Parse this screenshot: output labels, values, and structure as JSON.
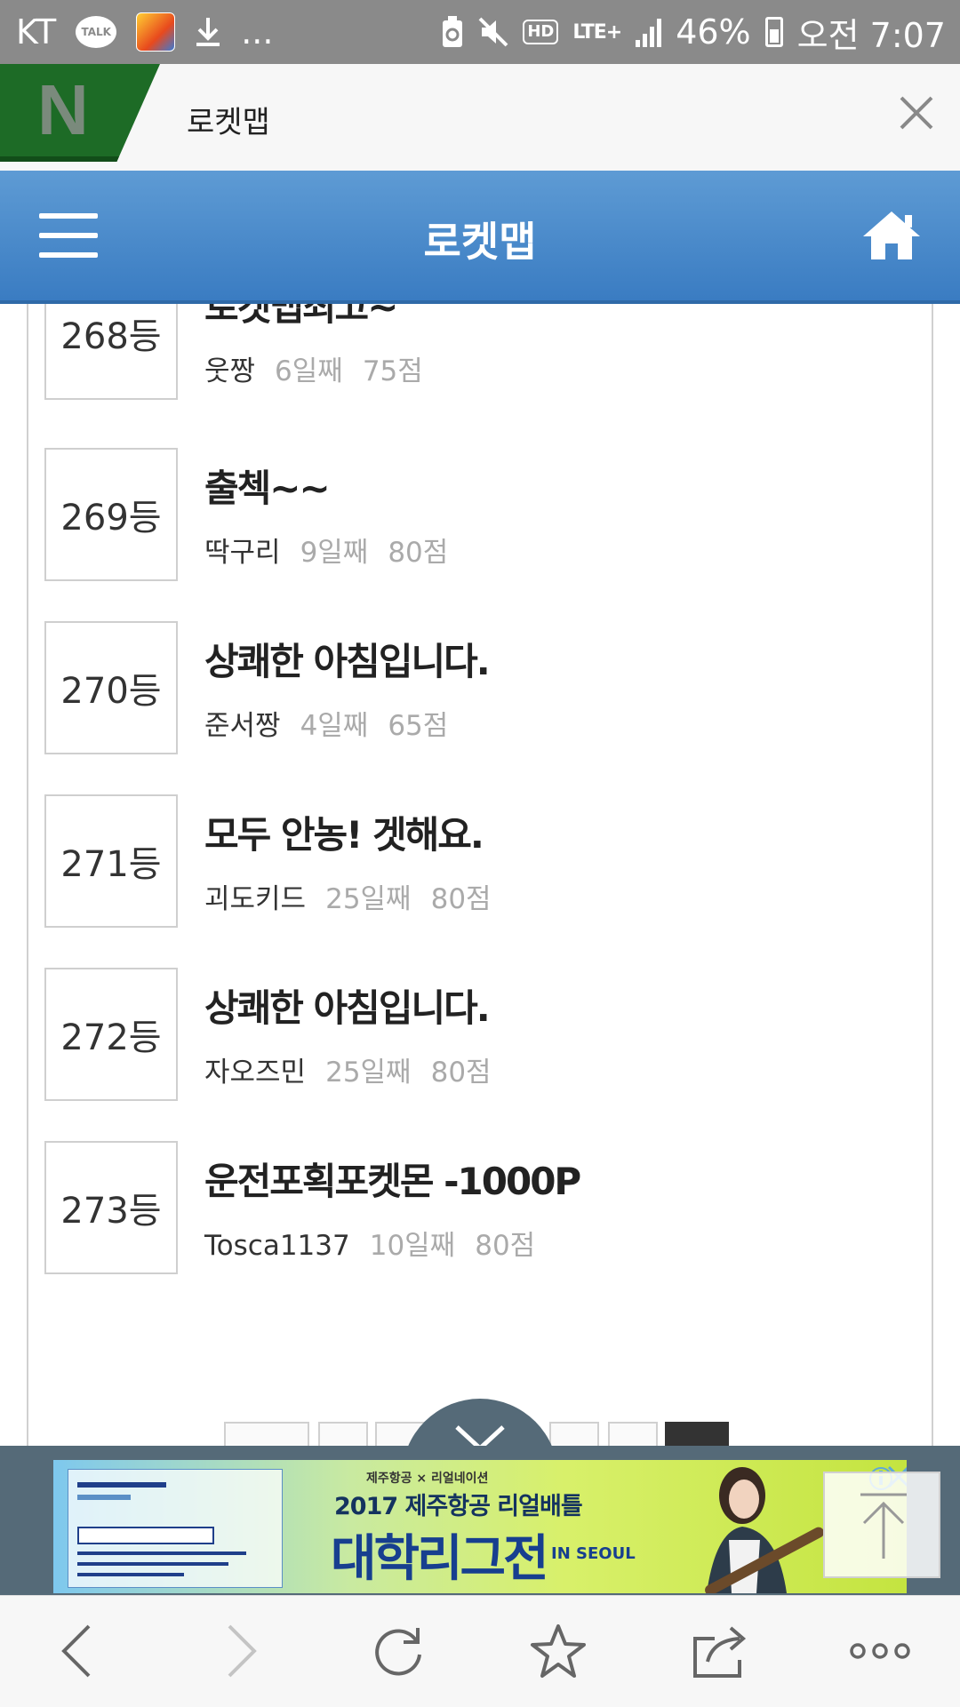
{
  "status_bar": {
    "carrier": "KT",
    "talk_label": "TALK",
    "more": "...",
    "hd": "HD",
    "network": "LTE+",
    "battery": "46%",
    "time": "오전 7:07"
  },
  "browser_tab": {
    "logo": "N",
    "title": "로켓맵"
  },
  "app_header": {
    "title": "로켓맵"
  },
  "list": [
    {
      "rank": "268등",
      "title": "로켓맵최고~",
      "nick": "웃짱",
      "days": "6일째",
      "score": "75점"
    },
    {
      "rank": "269등",
      "title": "출첵~~",
      "nick": "딱구리",
      "days": "9일째",
      "score": "80점"
    },
    {
      "rank": "270등",
      "title": "상쾌한 아침입니다.",
      "nick": "준서짱",
      "days": "4일째",
      "score": "65점"
    },
    {
      "rank": "271등",
      "title": "모두 안농! 겟해요.",
      "nick": "괴도키드",
      "days": "25일째",
      "score": "80점"
    },
    {
      "rank": "272등",
      "title": "상쾌한 아침입니다.",
      "nick": "자오즈민",
      "days": "25일째",
      "score": "80점"
    },
    {
      "rank": "273등",
      "title": "운전포획포켓몬 -1000P",
      "nick": "Tosca1137",
      "days": "10일째",
      "score": "80점"
    }
  ],
  "ad": {
    "sub": "제주항공 × 리얼네이션",
    "line1": "2017 제주항공 리얼배틀",
    "line2": "대학리그전",
    "in_seoul": "IN SEOUL"
  },
  "colors": {
    "header_blue": "#4a8bcc",
    "tab_green": "#1d6b26",
    "ad_bg": "#556a78"
  },
  "icons": [
    "kakao-talk-icon",
    "game-app-icon",
    "download-icon",
    "recycle-battery-icon",
    "mute-icon",
    "signal-icon",
    "battery-icon",
    "close-icon",
    "hamburger-icon",
    "home-icon",
    "chevron-down-icon",
    "info-icon",
    "arrow-up-icon",
    "back-icon",
    "forward-icon",
    "refresh-icon",
    "bookmark-star-icon",
    "share-icon",
    "more-icon"
  ]
}
